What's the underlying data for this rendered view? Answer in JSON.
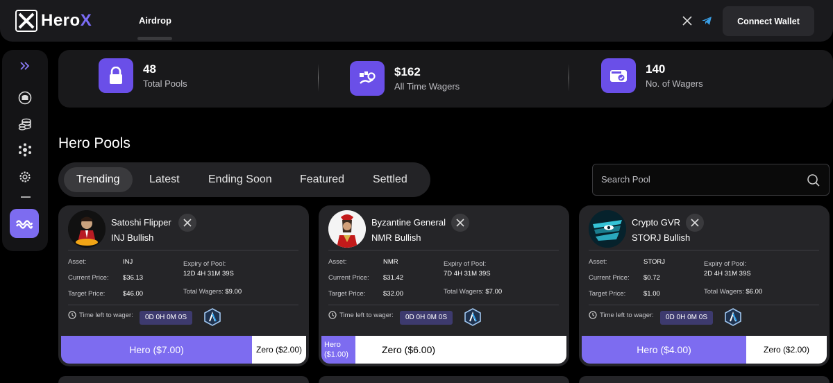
{
  "header": {
    "logo_text": "Hero",
    "logo_accent": "X",
    "nav_airdrop": "Airdrop",
    "connect_label": "Connect Wallet",
    "social_icons": [
      "x-icon",
      "telegram-icon"
    ]
  },
  "sidebar": {
    "items": [
      "chevrons-right-icon",
      "coin-icon",
      "coins-stack-icon",
      "network-icon",
      "settings-icon",
      "waves-icon"
    ]
  },
  "stats": [
    {
      "value": "48",
      "label": "Total Pools",
      "icon": "lock-icon"
    },
    {
      "value": "$162",
      "label": "All Time Wagers",
      "icon": "wager-icon"
    },
    {
      "value": "140",
      "label": "No. of Wagers",
      "icon": "wallet-check-icon"
    }
  ],
  "section_title": "Hero Pools",
  "tabs": [
    "Trending",
    "Latest",
    "Ending Soon",
    "Featured",
    "Settled"
  ],
  "active_tab": "Trending",
  "search": {
    "placeholder": "Search Pool"
  },
  "labels": {
    "asset": "Asset:",
    "current_price": "Current Price:",
    "target_price": "Target Price:",
    "expiry": "Expiry of Pool:",
    "total_wagers_prefix": "Total Wagers:",
    "time_left": "Time left to wager:"
  },
  "pools": [
    {
      "creator": "Satoshi Flipper",
      "prediction": "INJ Bullish",
      "asset": "INJ",
      "current_price": "$36.13",
      "target_price": "$46.00",
      "expiry": "12D 4H 31M 39S",
      "total_wagers": "$9.00",
      "time_left": "0D 0H 0M 0S",
      "hero_label": "Hero ($7.00)",
      "zero_label": "Zero ($2.00)",
      "hero_share": 0.78
    },
    {
      "creator": "Byzantine General",
      "prediction": "NMR Bullish",
      "asset": "NMR",
      "current_price": "$31.42",
      "target_price": "$32.00",
      "expiry": "7D 4H 31M 39S",
      "total_wagers": "$7.00",
      "time_left": "0D 0H 0M 0S",
      "hero_label": "Hero ($1.00)",
      "zero_label": "Zero ($6.00)",
      "hero_share": 0.14
    },
    {
      "creator": "Crypto GVR",
      "prediction": "STORJ Bullish",
      "asset": "STORJ",
      "current_price": "$0.72",
      "target_price": "$1.00",
      "expiry": "2D 4H 31M 39S",
      "total_wagers": "$6.00",
      "time_left": "0D 0H 0M 0S",
      "hero_label": "Hero ($4.00)",
      "zero_label": "Zero ($2.00)",
      "hero_share": 0.67
    }
  ],
  "colors": {
    "accent": "#7d6cf0",
    "card_bg": "#252528",
    "page_bg": "#000000"
  }
}
